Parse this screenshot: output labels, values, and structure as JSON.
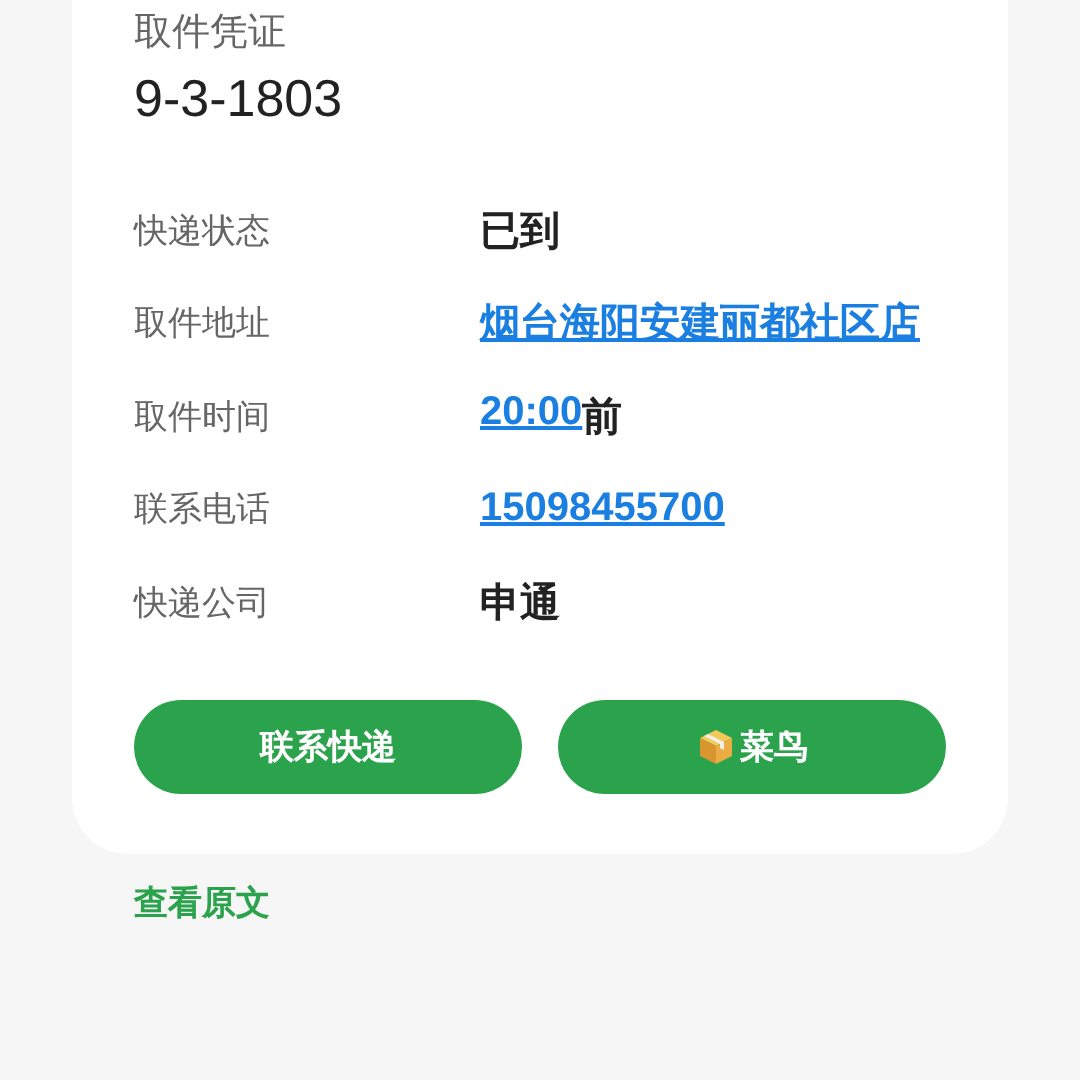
{
  "card": {
    "code_label": "取件凭证",
    "code": "9-3-1803",
    "rows": [
      {
        "label": "快递状态",
        "value": [
          {
            "text": "已到",
            "kind": "plain"
          }
        ]
      },
      {
        "label": "取件地址",
        "value": [
          {
            "text": "烟台海阳安建丽都社区店",
            "kind": "link"
          }
        ]
      },
      {
        "label": "取件时间",
        "value": [
          {
            "text": "20:00",
            "kind": "link"
          },
          {
            "text": "前",
            "kind": "plain"
          }
        ]
      },
      {
        "label": "联系电话",
        "value": [
          {
            "text": "15098455700",
            "kind": "link"
          }
        ]
      },
      {
        "label": "快递公司",
        "value": [
          {
            "text": "申通",
            "kind": "plain"
          }
        ]
      }
    ],
    "buttons": [
      {
        "label": "联系快递",
        "kind": "text"
      },
      {
        "label": "菜鸟",
        "kind": "with_icon"
      }
    ]
  },
  "footer_link": "查看原文"
}
